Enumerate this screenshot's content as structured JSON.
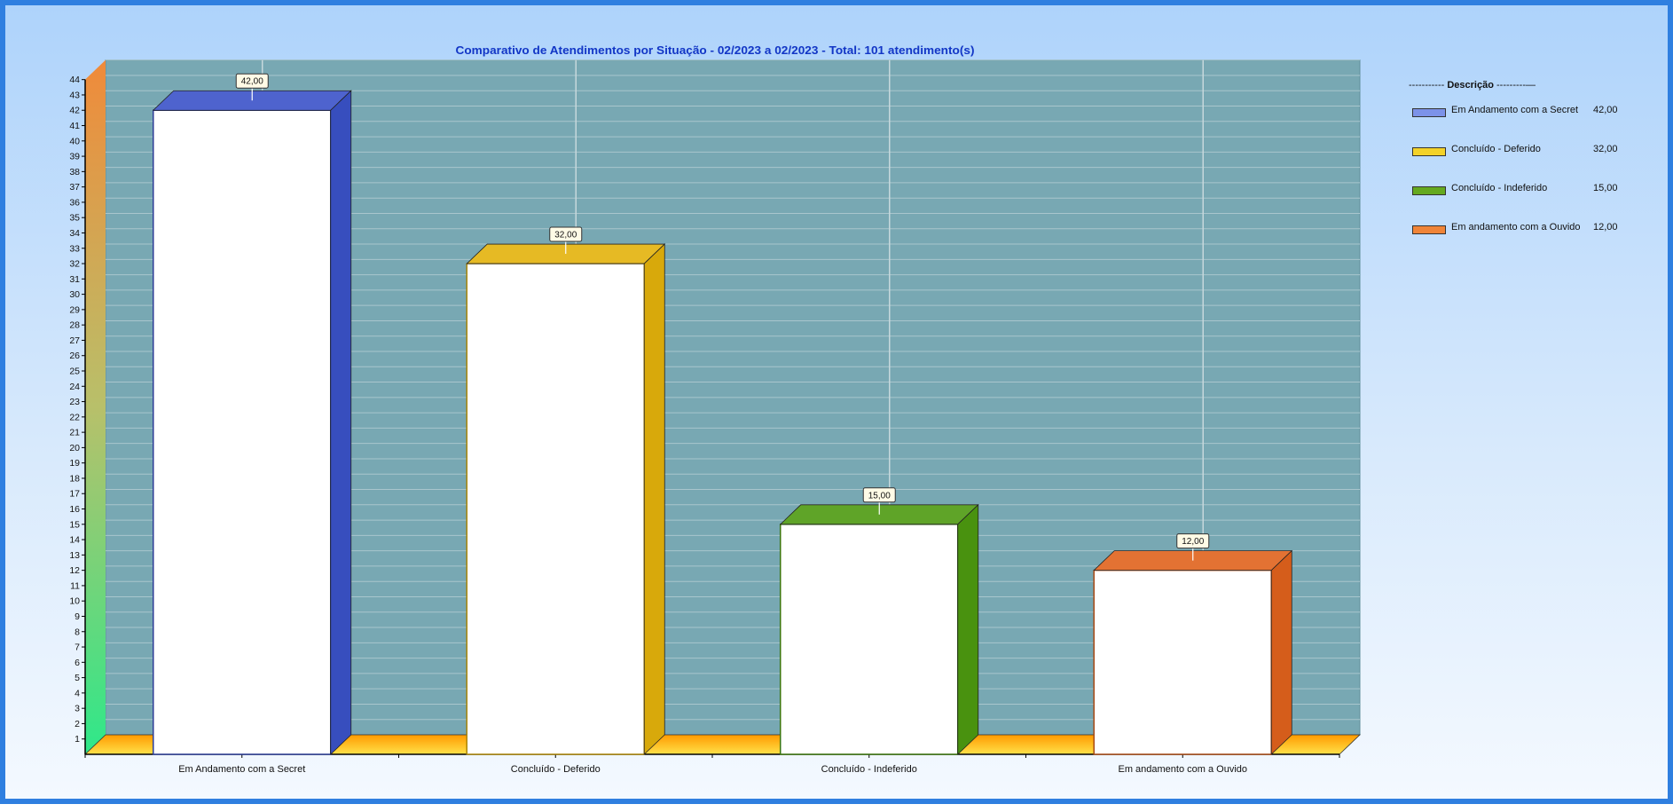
{
  "chart_data": {
    "type": "bar",
    "title": "Comparativo de Atendimentos por Situação - 02/2023 a 02/2023 - Total: 101 atendimento(s)",
    "categories": [
      "Em Andamento com a Secret",
      "Concluído - Deferido",
      "Concluído - Indeferido",
      "Em andamento com a Ouvido"
    ],
    "values": [
      42,
      32,
      15,
      12
    ],
    "value_labels": [
      "42,00",
      "32,00",
      "15,00",
      "12,00"
    ],
    "colors": [
      "#3a52c8",
      "#e3b20c",
      "#4d9a10",
      "#e0621c"
    ],
    "ylim": [
      0,
      44
    ],
    "yticks": [
      "1",
      "2",
      "3",
      "4",
      "5",
      "6",
      "7",
      "8",
      "9",
      "10",
      "11",
      "12",
      "13",
      "14",
      "15",
      "16",
      "17",
      "18",
      "19",
      "20",
      "21",
      "22",
      "23",
      "24",
      "25",
      "26",
      "27",
      "28",
      "29",
      "30",
      "31",
      "32",
      "33",
      "34",
      "35",
      "36",
      "37",
      "38",
      "39",
      "40",
      "41",
      "42",
      "43",
      "44"
    ],
    "xlabel": "",
    "ylabel": "",
    "grid": true,
    "legend_position": "right",
    "plot_background": "#78a8b3"
  },
  "legend": {
    "title_prefix": "----------- ",
    "title": "Descrição",
    "title_suffix": " ---------—",
    "items": [
      {
        "label": "Em Andamento com a Secret",
        "value": "42,00",
        "color": "#7c92e8"
      },
      {
        "label": "Concluído - Deferido",
        "value": "32,00",
        "color": "#f3d22a"
      },
      {
        "label": "Concluído - Indeferido",
        "value": "15,00",
        "color": "#65a920"
      },
      {
        "label": "Em andamento com a Ouvido",
        "value": "12,00",
        "color": "#f08438"
      }
    ]
  }
}
